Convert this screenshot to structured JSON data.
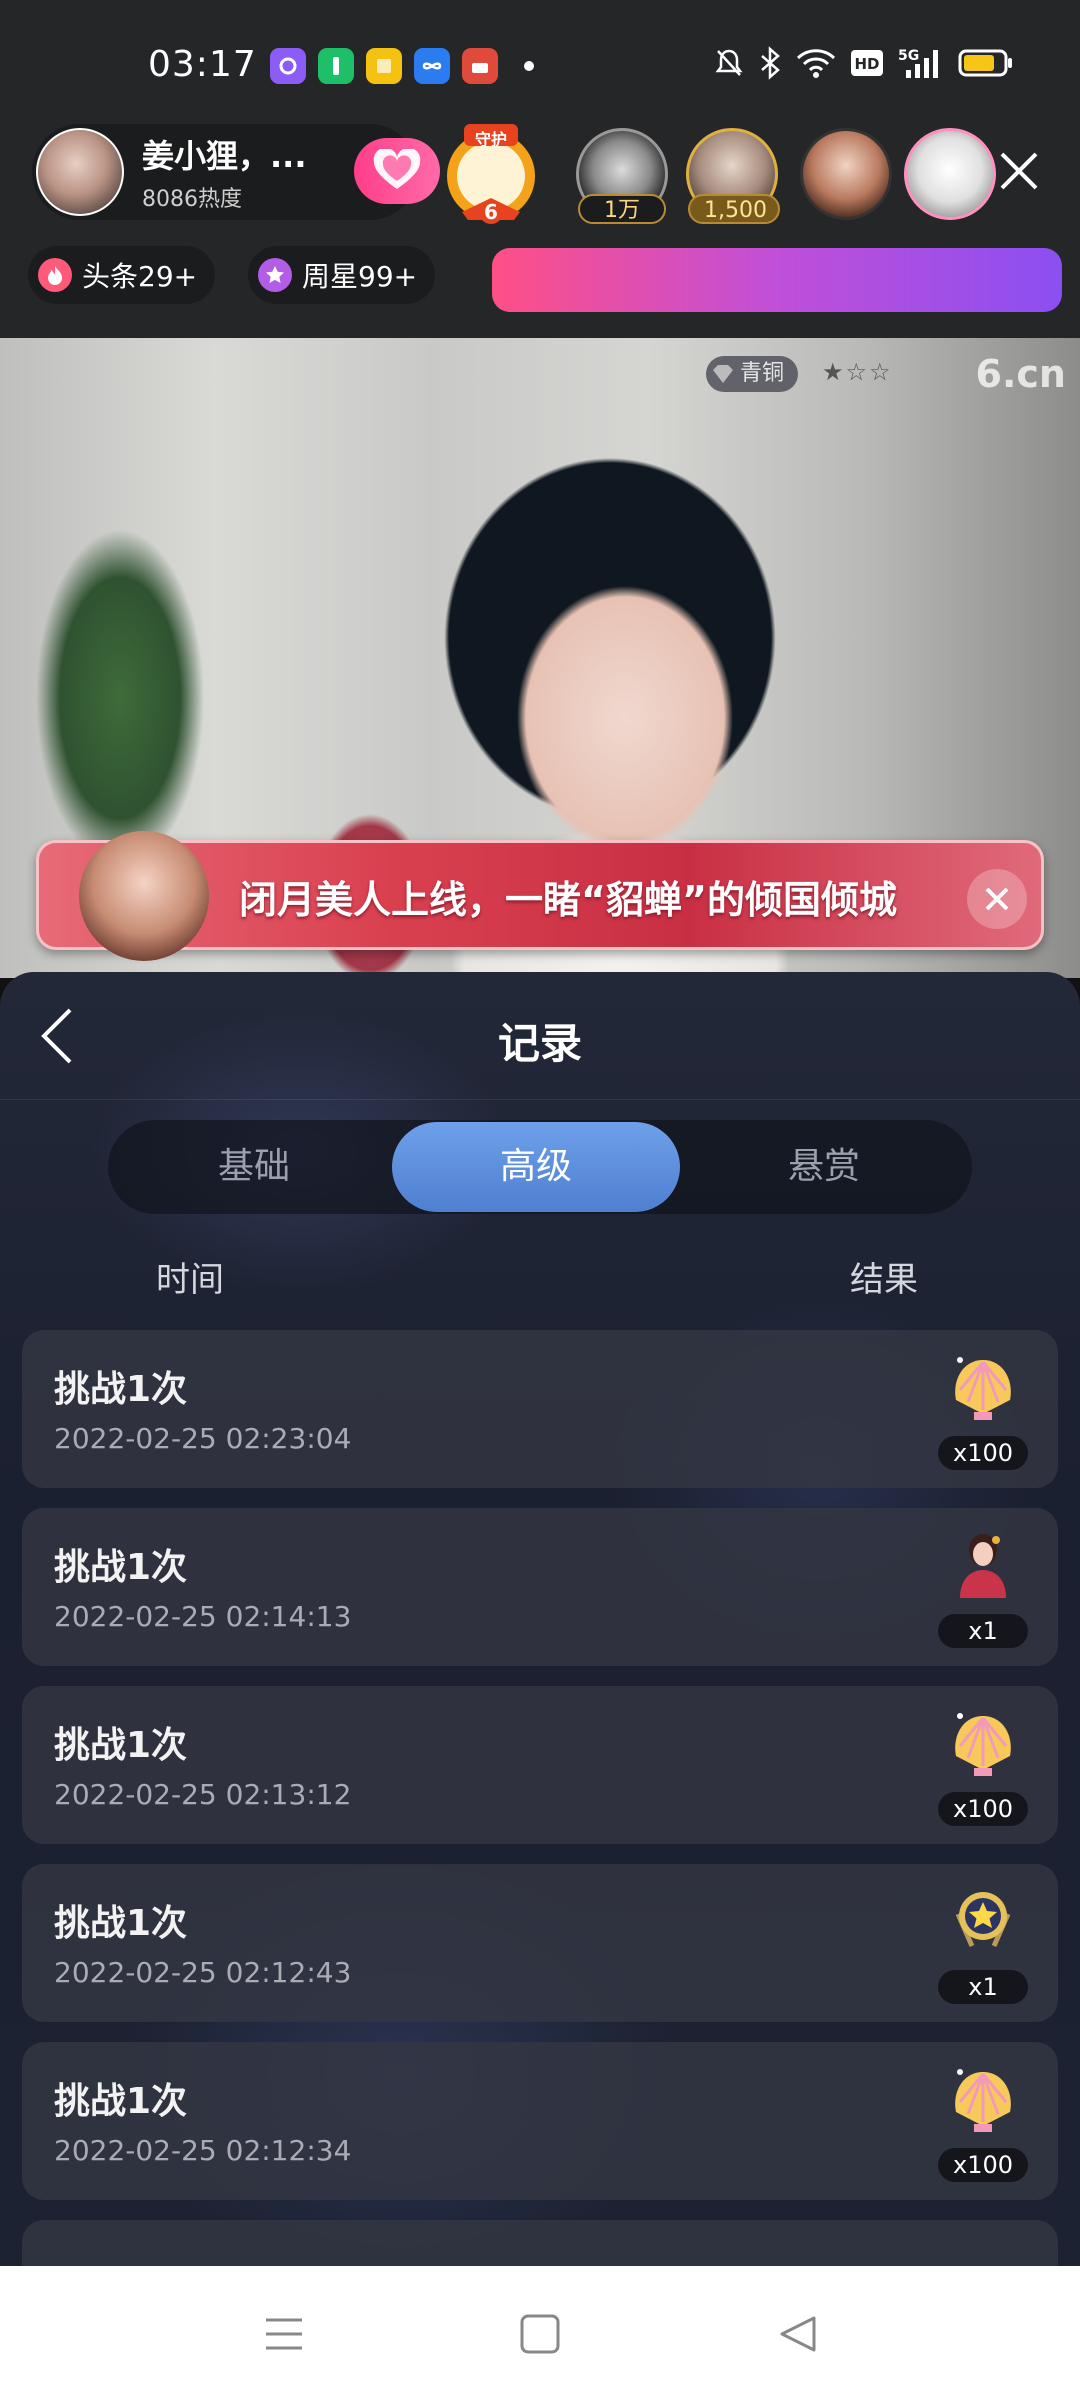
{
  "status_bar": {
    "time": "03:17",
    "notification_icons": [
      "camera-app-icon",
      "wechat-icon",
      "notes-icon",
      "infinity-app-icon",
      "game-app-icon"
    ],
    "system_icons": [
      "silent-icon",
      "bluetooth-icon",
      "wifi-icon",
      "hd-icon",
      "5g-signal-icon",
      "battery-icon"
    ]
  },
  "host": {
    "name": "姜小狸，...",
    "heat": "8086热度"
  },
  "guard_badge": {
    "label": "守护",
    "count": "6"
  },
  "viewers": [
    {
      "badge": "1万"
    },
    {
      "badge": "1,500"
    },
    {
      "badge": ""
    },
    {
      "badge": ""
    }
  ],
  "chips": {
    "headlines": "头条29+",
    "weekly_star": "周星99+"
  },
  "video": {
    "rank_label": "青铜",
    "rank_stars": "★☆☆",
    "watermark": "6.cn"
  },
  "promo_banner": {
    "text": "闭月美人上线，一睹“貂蝉”的倾国倾城"
  },
  "panel": {
    "title": "记录",
    "tabs": [
      {
        "label": "基础",
        "active": false
      },
      {
        "label": "高级",
        "active": true
      },
      {
        "label": "悬赏",
        "active": false
      }
    ],
    "columns": {
      "time": "时间",
      "result": "结果"
    },
    "records": [
      {
        "title": "挑战1次",
        "time": "2022-02-25 02:23:04",
        "reward": "shell-icon",
        "qty": "x100"
      },
      {
        "title": "挑战1次",
        "time": "2022-02-25 02:14:13",
        "reward": "diaochan-avatar-icon",
        "qty": "x1"
      },
      {
        "title": "挑战1次",
        "time": "2022-02-25 02:13:12",
        "reward": "shell-icon",
        "qty": "x100"
      },
      {
        "title": "挑战1次",
        "time": "2022-02-25 02:12:43",
        "reward": "star-medal-icon",
        "qty": "x1"
      },
      {
        "title": "挑战1次",
        "time": "2022-02-25 02:12:34",
        "reward": "shell-icon",
        "qty": "x100"
      }
    ]
  },
  "colors": {
    "accent_tab": "#5f8fde",
    "follow_pink": "#ff4d95",
    "gradient_bar_start": "#ff4f86",
    "gradient_bar_end": "#8b4ff0"
  }
}
